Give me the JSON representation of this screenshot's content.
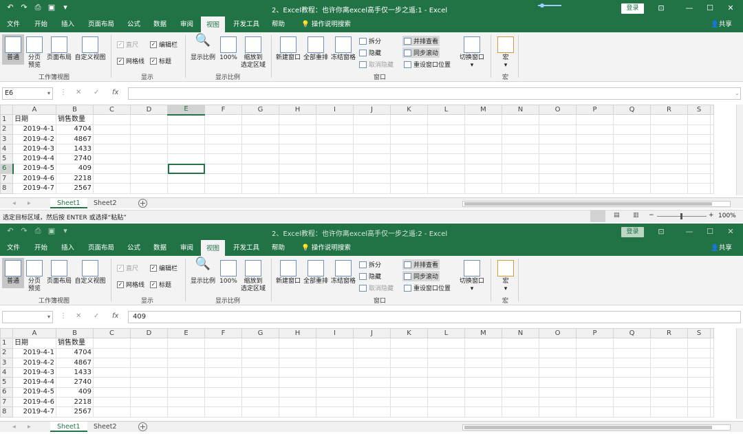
{
  "windows": [
    {
      "qat": {
        "undo_icon": "↶",
        "redo_icon": "↷",
        "preview_icon": "⎙",
        "save_icon": "💾",
        "customize_icon": "▾"
      },
      "title": "2、Excel教程：也许你离excel高手仅一步之遥:1  -  Excel",
      "login": "登录",
      "tabs": [
        "文件",
        "开始",
        "插入",
        "页面布局",
        "公式",
        "数据",
        "审阅",
        "视图",
        "开发工具",
        "帮助"
      ],
      "tell_me": "操作说明搜索",
      "share": "共享",
      "ribbon": {
        "normal": "普通",
        "page_break": "分页\n预览",
        "page_layout": "页面布局",
        "custom_views": "自定义视图",
        "group_workbook_views": "工作簿视图",
        "ruler": "直尺",
        "formula_bar": "编辑栏",
        "gridlines": "网格线",
        "headings": "标题",
        "group_show": "显示",
        "zoom": "显示比例",
        "zoom100": "100%",
        "zoom_selection": "缩放到\n选定区域",
        "group_zoom": "显示比例",
        "new_window": "新建窗口",
        "arrange_all": "全部重排",
        "freeze_panes": "冻结窗格",
        "split": "拆分",
        "hide": "隐藏",
        "unhide": "取消隐藏",
        "view_side_by_side": "并排查看",
        "sync_scroll": "同步滚动",
        "reset_position": "重设窗口位置",
        "group_window": "窗口",
        "switch_windows": "切换窗口",
        "macros": "宏",
        "group_macros": "宏"
      },
      "name_box": "E6",
      "formula": "",
      "status_text": "选定目标区域，然后按 ENTER 或选择“粘贴”",
      "zoom_level": "100%"
    },
    {
      "title": "2、Excel教程：也许你离excel高手仅一步之遥:2  -  Excel",
      "login": "登录",
      "name_box": "",
      "formula": "409"
    }
  ],
  "sheet": {
    "columns": [
      "A",
      "B",
      "C",
      "D",
      "E",
      "F",
      "G",
      "H",
      "I",
      "J",
      "K",
      "L",
      "M",
      "N",
      "O",
      "P",
      "Q",
      "R",
      "S"
    ],
    "rows": [
      {
        "n": "1",
        "a": "日期",
        "b": "销售数量"
      },
      {
        "n": "2",
        "a": "2019-4-1",
        "b": "4704"
      },
      {
        "n": "3",
        "a": "2019-4-2",
        "b": "4867"
      },
      {
        "n": "4",
        "a": "2019-4-3",
        "b": "1433"
      },
      {
        "n": "5",
        "a": "2019-4-4",
        "b": "2740"
      },
      {
        "n": "6",
        "a": "2019-4-5",
        "b": "409"
      },
      {
        "n": "7",
        "a": "2019-4-6",
        "b": "2218"
      },
      {
        "n": "8",
        "a": "2019-4-7",
        "b": "2567"
      }
    ],
    "tabs": [
      "Sheet1",
      "Sheet2"
    ]
  },
  "colors": {
    "accent": "#217346",
    "ribbon": "#f3f3f3"
  }
}
